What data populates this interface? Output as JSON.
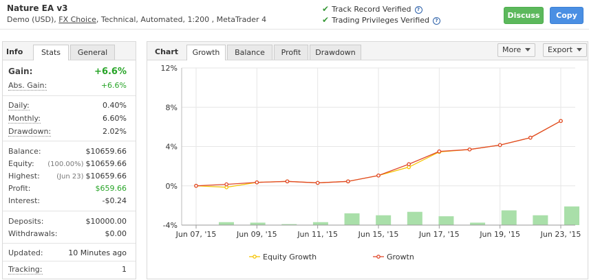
{
  "header": {
    "name": "Nature EA v3",
    "desc_pre": "Demo (USD), ",
    "desc_link": "FX Choice",
    "desc_post": ", Technical, Automated, 1:200 , MetaTrader 4",
    "verify": [
      "Track Record Verified",
      "Trading Privileges Verified"
    ],
    "discuss_label": "Discuss",
    "copy_label": "Copy"
  },
  "left_tabs": {
    "info": "Info",
    "stats": "Stats",
    "general": "General"
  },
  "stats": {
    "gain_label": "Gain:",
    "gain_value": "+6.6%",
    "abs_gain_label": "Abs. Gain:",
    "abs_gain_value": "+6.6%",
    "daily_label": "Daily:",
    "daily_value": "0.40%",
    "monthly_label": "Monthly:",
    "monthly_value": "6.60%",
    "drawdown_label": "Drawdown:",
    "drawdown_value": "2.02%",
    "balance_label": "Balance:",
    "balance_value": "$10659.66",
    "equity_label": "Equity:",
    "equity_pre": "(100.00%)",
    "equity_value": "$10659.66",
    "highest_label": "Highest:",
    "highest_pre": "(Jun 23)",
    "highest_value": "$10659.66",
    "profit_label": "Profit:",
    "profit_value": "$659.66",
    "interest_label": "Interest:",
    "interest_value": "-$0.24",
    "deposits_label": "Deposits:",
    "deposits_value": "$10000.00",
    "withdrawals_label": "Withdrawals:",
    "withdrawals_value": "$0.00",
    "updated_label": "Updated:",
    "updated_value": "10 Minutes ago",
    "tracking_label": "Tracking:",
    "tracking_value": "1"
  },
  "chart_tabs": {
    "label": "Chart",
    "tabs": [
      "Growth",
      "Balance",
      "Profit",
      "Drawdown"
    ],
    "more_label": "More",
    "export_label": "Export"
  },
  "colors": {
    "equity": "#f5c400",
    "growth": "#e0472a",
    "bars": "#a9dfa9",
    "green_btn": "#5cb85c",
    "blue_btn": "#4a8fe3"
  },
  "chart_data": {
    "type": "line",
    "x_tick_labels": [
      "Jun 07, '15",
      "Jun 09, '15",
      "Jun 11, '15",
      "Jun 15, '15",
      "Jun 17, '15",
      "Jun 19, '15",
      "Jun 23, '15"
    ],
    "y_tick_labels": [
      "12%",
      "8%",
      "4%",
      "0%",
      "-4%"
    ],
    "ylim": [
      -4,
      12
    ],
    "grid": true,
    "legend_position": "bottom",
    "series": [
      {
        "name": "Equity Growth",
        "values": [
          0.0,
          -0.15,
          0.35,
          0.45,
          0.3,
          0.45,
          1.05,
          1.9,
          3.45,
          3.7,
          4.15,
          4.9,
          6.6
        ]
      },
      {
        "name": "Growtn",
        "values": [
          0.0,
          0.15,
          0.35,
          0.45,
          0.3,
          0.45,
          1.05,
          2.2,
          3.5,
          3.7,
          4.15,
          4.9,
          6.6
        ]
      }
    ],
    "bars": [
      0.3,
      0.25,
      0.1,
      0.3,
      1.2,
      1.0,
      1.35,
      0.9,
      0.25,
      1.5,
      1.0,
      1.9
    ]
  }
}
